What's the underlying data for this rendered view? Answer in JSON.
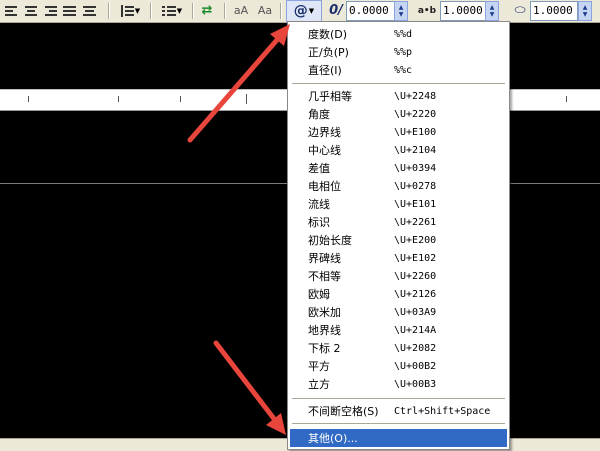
{
  "toolbar": {
    "buttons": [
      "aA",
      "Aa"
    ],
    "at_symbol": "@",
    "oblique_label": "0/",
    "oblique_value": "0.0000",
    "tracking_label": "a•b",
    "tracking_value": "1.0000",
    "width_value": "1.0000"
  },
  "menu": {
    "group1": [
      {
        "label": "度数(D)",
        "code": "%%d"
      },
      {
        "label": "正/负(P)",
        "code": "%%p"
      },
      {
        "label": "直径(I)",
        "code": "%%c"
      }
    ],
    "group2": [
      {
        "label": "几乎相等",
        "code": "\\U+2248"
      },
      {
        "label": "角度",
        "code": "\\U+2220"
      },
      {
        "label": "边界线",
        "code": "\\U+E100"
      },
      {
        "label": "中心线",
        "code": "\\U+2104"
      },
      {
        "label": "差值",
        "code": "\\U+0394"
      },
      {
        "label": "电相位",
        "code": "\\U+0278"
      },
      {
        "label": "流线",
        "code": "\\U+E101"
      },
      {
        "label": "标识",
        "code": "\\U+2261"
      },
      {
        "label": "初始长度",
        "code": "\\U+E200"
      },
      {
        "label": "界碑线",
        "code": "\\U+E102"
      },
      {
        "label": "不相等",
        "code": "\\U+2260"
      },
      {
        "label": "欧姆",
        "code": "\\U+2126"
      },
      {
        "label": "欧米加",
        "code": "\\U+03A9"
      },
      {
        "label": "地界线",
        "code": "\\U+214A"
      },
      {
        "label": "下标 2",
        "code": "\\U+2082"
      },
      {
        "label": "平方",
        "code": "\\U+00B2"
      },
      {
        "label": "立方",
        "code": "\\U+00B3"
      }
    ],
    "nbsp": {
      "label": "不间断空格(S)",
      "code": "Ctrl+Shift+Space"
    },
    "other": {
      "label": "其他(O)..."
    }
  },
  "colors": {
    "highlight": "#316ac5",
    "arrow": "#e8453c"
  }
}
